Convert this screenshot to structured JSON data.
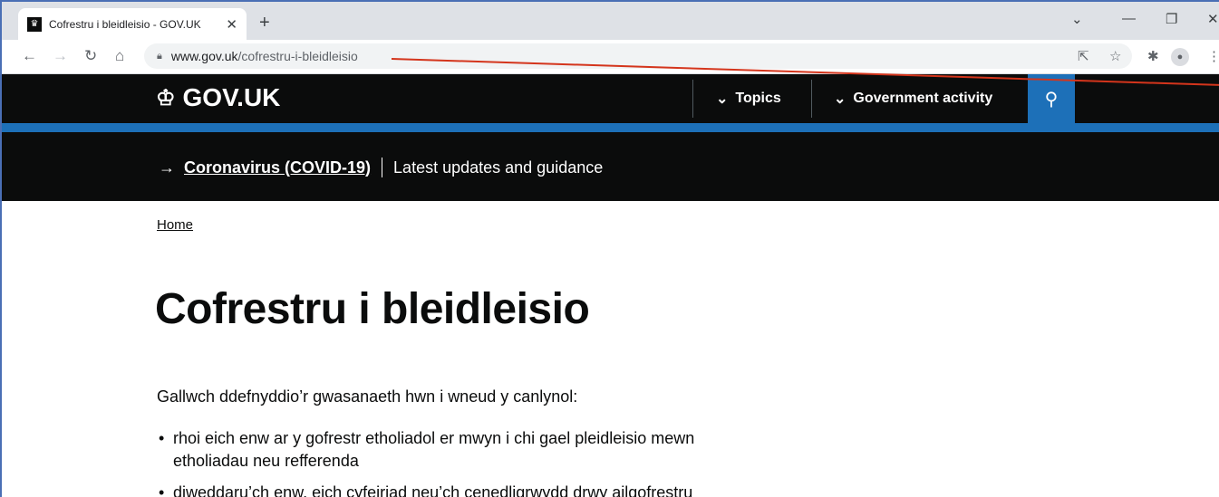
{
  "browser": {
    "tab_title": "Cofrestru i bleidleisio - GOV.UK",
    "tab_close": "✕",
    "new_tab": "+",
    "favicon": "crown-icon",
    "url_host": "www.gov.uk",
    "url_path": "/cofrestru-i-bleidleisio",
    "back": "←",
    "forward": "→",
    "reload": "↻",
    "home": "⌂",
    "share": "⇱",
    "star": "☆",
    "extensions": "✱",
    "menu": "⋮",
    "win_dropdown": "⌄",
    "win_min": "—",
    "win_restore": "❐",
    "win_close": "✕"
  },
  "header": {
    "logo_text": "GOV.UK",
    "topics_label": "Topics",
    "activity_label": "Government activity",
    "chevron": "⌄",
    "search_glyph": "⚲"
  },
  "covid": {
    "arrow": "→",
    "link_text": "Coronavirus (COVID-19)",
    "description": "Latest updates and guidance"
  },
  "main": {
    "breadcrumb": "Home",
    "title": "Cofrestru i bleidleisio",
    "lead": "Gallwch ddefnyddio’r gwasanaeth hwn i wneud y canlynol:",
    "bullets": [
      "rhoi eich enw ar y gofrestr etholiadol er mwyn i chi gael pleidleisio mewn etholiadau neu refferenda",
      "diweddaru’ch enw, eich cyfeiriad neu’ch cenedligrwydd drwy ailgofrestru"
    ]
  },
  "colors": {
    "gov_black": "#0b0c0c",
    "gov_blue": "#1d70b8",
    "annotation_red": "#d4351c"
  }
}
